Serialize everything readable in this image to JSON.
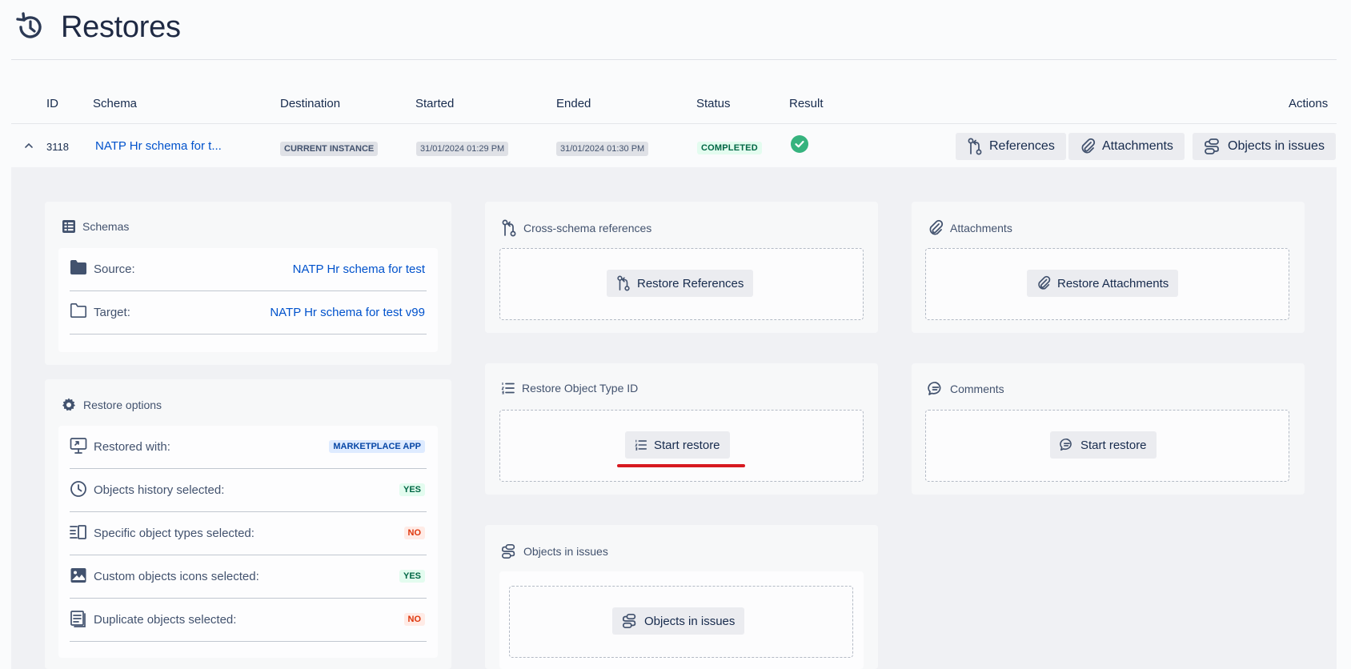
{
  "page": {
    "title": "Restores"
  },
  "table": {
    "headers": {
      "id": "ID",
      "schema": "Schema",
      "destination": "Destination",
      "started": "Started",
      "ended": "Ended",
      "status": "Status",
      "result": "Result",
      "actions": "Actions"
    },
    "row": {
      "id": "3118",
      "schema": "NATP Hr schema for t...",
      "destination": "CURRENT INSTANCE",
      "started": "31/01/2024 01:29 PM",
      "ended": "31/01/2024 01:30 PM",
      "status": "COMPLETED",
      "result_icon": "check-circle-icon",
      "actions": {
        "references": "References",
        "attachments": "Attachments",
        "objects_in_issues": "Objects in issues"
      }
    }
  },
  "schemas": {
    "title": "Schemas",
    "source_label": "Source:",
    "source_value": "NATP Hr schema for test",
    "target_label": "Target:",
    "target_value": "NATP Hr schema for test v99"
  },
  "restore_options": {
    "title": "Restore options",
    "items": [
      {
        "label": "Restored with:",
        "value": "MARKETPLACE APP"
      },
      {
        "label": "Objects history selected:",
        "value": "YES"
      },
      {
        "label": "Specific object types selected:",
        "value": "NO"
      },
      {
        "label": "Custom objects icons selected:",
        "value": "YES"
      },
      {
        "label": "Duplicate objects selected:",
        "value": "NO"
      }
    ]
  },
  "cross_refs": {
    "title": "Cross-schema references",
    "button": "Restore References"
  },
  "attachments": {
    "title": "Attachments",
    "button": "Restore Attachments"
  },
  "object_type_id": {
    "title": "Restore Object Type ID",
    "button": "Start restore"
  },
  "comments": {
    "title": "Comments",
    "button": "Start restore"
  },
  "objects_in_issues": {
    "title": "Objects in issues",
    "button": "Objects in issues"
  },
  "colors": {
    "link": "#0052cc",
    "success": "#36b37e",
    "danger": "#de350b",
    "annotation": "#d71920"
  }
}
